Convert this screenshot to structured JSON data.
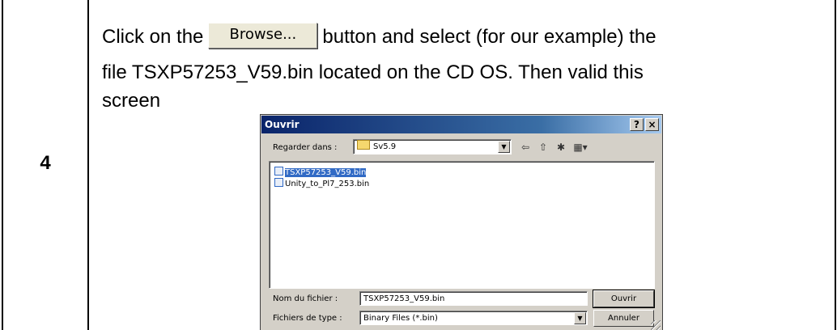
{
  "step": {
    "number": "4"
  },
  "instruction": {
    "before_button": "Click on the",
    "inline_button_label": "Browse...",
    "after_button_line1": "button and select (for our example) the",
    "line2": "file TSXP57253_V59.bin located on the CD OS. Then valid this",
    "line3": "screen"
  },
  "dialog": {
    "title": "Ouvrir",
    "help_label": "?",
    "close_label": "×",
    "look_in_label": "Regarder dans :",
    "look_in_value": "Sv5.9",
    "toolbar_icons": [
      "back-icon",
      "up-folder-icon",
      "new-folder-icon",
      "view-menu-icon"
    ],
    "files": [
      {
        "name": "TSXP57253_V59.bin",
        "selected": true
      },
      {
        "name": "Unity_to_Pl7_253.bin",
        "selected": false
      }
    ],
    "filename_label": "Nom du fichier :",
    "filename_value": "TSXP57253_V59.bin",
    "filetype_label": "Fichiers de type :",
    "filetype_value": "Binary Files (*.bin)",
    "open_button": "Ouvrir",
    "cancel_button": "Annuler"
  },
  "colors": {
    "titlebar": "#0a246a",
    "dialog_bg": "#d4d0c8",
    "selection": "#316ac5"
  }
}
